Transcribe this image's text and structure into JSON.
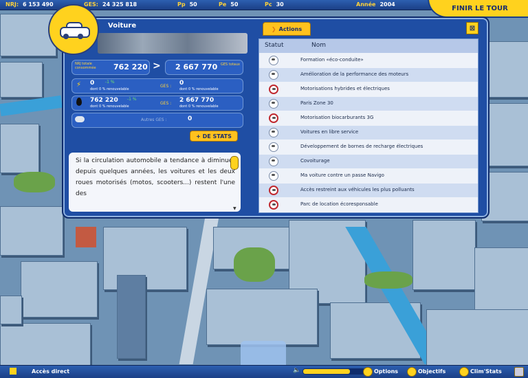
{
  "topbar": {
    "nrj_label": "NRJ:",
    "nrj_value": "6 153 490",
    "ges_label": "GES:",
    "ges_value": "24 325 818",
    "pp_label": "Pp",
    "pp_value": "50",
    "pe_label": "Pe",
    "pe_value": "50",
    "pc_label": "Pc",
    "pc_value": "30",
    "annee_label": "Année",
    "annee_value": "2004",
    "finish_label": "Finir le tour"
  },
  "sector": {
    "title": "Voiture",
    "nrj_total_label": "NRJ totale consommée",
    "nrj_total": "762 220",
    "ges_total_label": "GES totaux",
    "ges_total": "2 667 770",
    "elec_value": "0",
    "elec_renew": "dont 0 % renouvelable",
    "elec_change": "-1 %",
    "elec_ges_label": "GES :",
    "elec_ges": "0",
    "elec_ges_renew": "dont 0 % renouvelable",
    "oil_value": "762 220",
    "oil_renew": "dont 0 % renouvelable",
    "oil_change": "-1 %",
    "oil_ges_label": "GES :",
    "oil_ges": "2 667 770",
    "oil_ges_renew": "dont 0 % renouvelable",
    "other_ges_label": "Autres GES :",
    "other_ges": "0",
    "stats_button": "+ de Stats",
    "description": "Si la circulation automobile a tendance à diminuer depuis quelques années, les voitures et les deux roues motorisés (motos, scooters...) restent l'une des"
  },
  "actions": {
    "tab_label": "Actions",
    "col_status": "Statut",
    "col_name": "Nom",
    "items": [
      {
        "name": "Formation «éco-conduite»",
        "bad": false
      },
      {
        "name": "Amélioration de la performance des moteurs",
        "bad": false
      },
      {
        "name": "Motorisations hybrides et électriques",
        "bad": true
      },
      {
        "name": "Paris Zone 30",
        "bad": false
      },
      {
        "name": "Motorisation biocarburants 3G",
        "bad": true
      },
      {
        "name": "Voitures en libre service",
        "bad": false
      },
      {
        "name": "Développement de bornes de recharge électriques",
        "bad": false
      },
      {
        "name": "Covoiturage",
        "bad": false
      },
      {
        "name": "Ma voiture contre un passe Navigo",
        "bad": false
      },
      {
        "name": "Accès restreint aux véhicules les plus polluants",
        "bad": true
      },
      {
        "name": "Parc de location écoresponsable",
        "bad": true
      }
    ]
  },
  "bottombar": {
    "direct_access": "Accès direct",
    "options": "Options",
    "objectifs": "Objectifs",
    "climstats": "Clim'Stats",
    "volume": 0.75
  },
  "colors": {
    "accent": "#ffd21e",
    "panel": "#1f4ea4",
    "bar": "#1b3f86"
  }
}
